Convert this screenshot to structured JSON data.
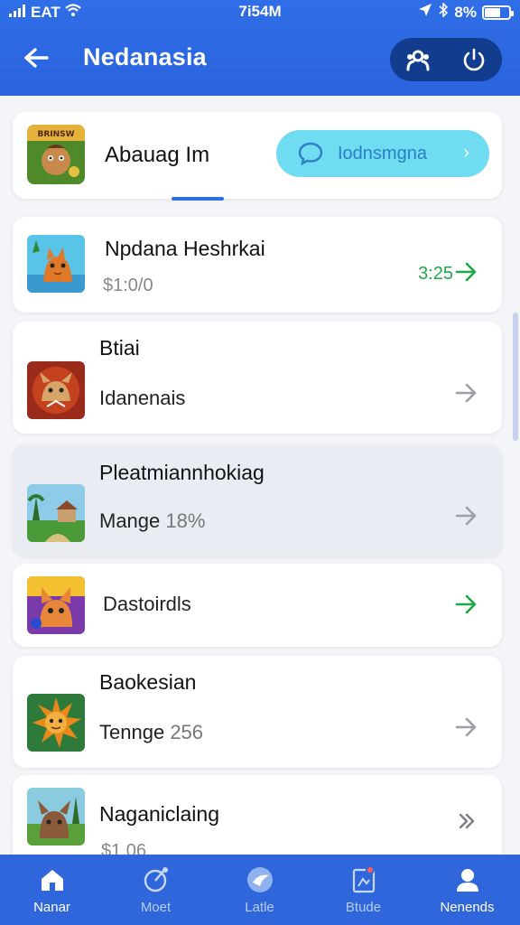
{
  "status_bar": {
    "carrier": "EAT",
    "time": "7i54M",
    "battery": "8%"
  },
  "header": {
    "title": "Nedanasia",
    "icons": [
      "back-arrow-icon",
      "people-icon",
      "power-icon"
    ]
  },
  "top_card": {
    "name": "Abauag Im",
    "button_label": "Iodnsmgna",
    "thumb_text": "BRINSW"
  },
  "list": [
    {
      "title": "Npdana Heshrkai",
      "sub": "$1:0/0",
      "right_value": "3:25",
      "arrow": "green"
    },
    {
      "title": "Btiai",
      "sub": "Idanenais",
      "right_value": "",
      "arrow": "gray"
    },
    {
      "title": "Pleatmiannhokiag",
      "sub": "Mange",
      "sub_value": "18%",
      "right_value": "",
      "arrow": "gray",
      "highlighted": true
    },
    {
      "title": "",
      "sub": "Dastoirdls",
      "right_value": "",
      "arrow": "green"
    },
    {
      "title": "Baokesian",
      "sub": "Tenngе",
      "sub_value": "256",
      "right_value": "",
      "arrow": "gray"
    },
    {
      "title": "Naganiclaing",
      "sub": "$1.06",
      "right_value": "",
      "arrow": "double-chevron"
    }
  ],
  "bottom_nav": [
    {
      "label": "Nanar",
      "icon": "home-icon",
      "active": true
    },
    {
      "label": "Moet",
      "icon": "chart-icon",
      "active": false
    },
    {
      "label": "Latle",
      "icon": "bird-icon",
      "active": false
    },
    {
      "label": "Btude",
      "icon": "document-icon",
      "active": false
    },
    {
      "label": "Nenends",
      "icon": "person-icon",
      "active": true
    }
  ],
  "colors": {
    "primary": "#2f6ee6",
    "header_pill": "#123d8e",
    "accent_pill": "#6fdcf2",
    "green": "#1fa84a"
  }
}
